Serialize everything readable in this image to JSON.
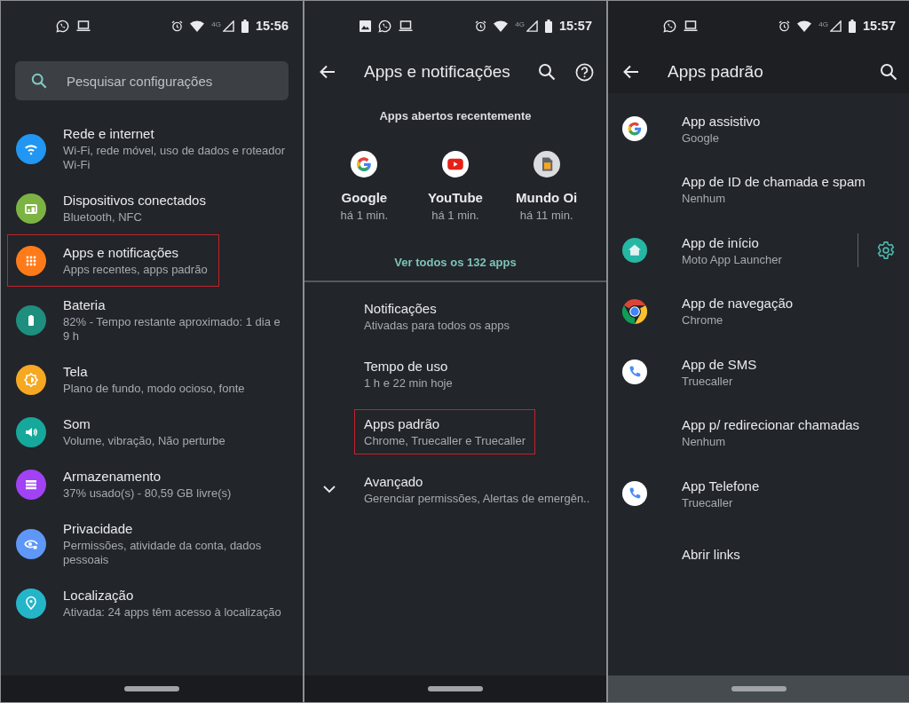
{
  "screens": [
    {
      "kind": "home",
      "status_bar": {
        "notifications": [
          {
            "kind": "chat"
          },
          {
            "kind": "laptop"
          }
        ],
        "network": "4G",
        "time": "15:56"
      },
      "search": {
        "placeholder": "Pesquisar configurações"
      },
      "items": [
        {
          "kind": "wifi",
          "color": "#2196f3",
          "title": "Rede e internet",
          "subtitle": "Wi-Fi, rede móvel, uso de dados e roteador Wi-Fi",
          "highlighted": false
        },
        {
          "kind": "devices",
          "color": "#7cb342",
          "title": "Dispositivos conectados",
          "subtitle": "Bluetooth, NFC",
          "highlighted": false
        },
        {
          "kind": "apps",
          "color": "#ff7b1a",
          "title": "Apps e notificações",
          "subtitle": "Apps recentes, apps padrão",
          "highlighted": true
        },
        {
          "kind": "battery",
          "color": "#1e8e7e",
          "title": "Bateria",
          "subtitle": "82% - Tempo restante aproximado: 1 dia e 9 h",
          "highlighted": false
        },
        {
          "kind": "display",
          "color": "#f6a823",
          "title": "Tela",
          "subtitle": "Plano de fundo, modo ocioso, fonte",
          "highlighted": false
        },
        {
          "kind": "sound",
          "color": "#16a89a",
          "title": "Som",
          "subtitle": "Volume, vibração, Não perturbe",
          "highlighted": false
        },
        {
          "kind": "storage",
          "color": "#a142f4",
          "title": "Armazenamento",
          "subtitle": "37% usado(s) - 80,59 GB livre(s)",
          "highlighted": false
        },
        {
          "kind": "privacy",
          "color": "#5e97f6",
          "title": "Privacidade",
          "subtitle": "Permissões, atividade da conta, dados pessoais",
          "highlighted": false
        },
        {
          "kind": "location",
          "color": "#24b5c9",
          "title": "Localização",
          "subtitle": "Ativada: 24 apps têm acesso à localização",
          "highlighted": false
        }
      ]
    },
    {
      "kind": "apps",
      "status_bar": {
        "notifications": [
          {
            "kind": "image"
          },
          {
            "kind": "chat"
          },
          {
            "kind": "laptop"
          }
        ],
        "network": "4G",
        "time": "15:57"
      },
      "toolbar": {
        "title": "Apps e notificações",
        "actions": [
          {
            "kind": "search"
          },
          {
            "kind": "help"
          }
        ]
      },
      "recent": {
        "heading": "Apps abertos recentemente",
        "apps": [
          {
            "kind": "google",
            "name": "Google",
            "time": "há 1 min."
          },
          {
            "kind": "youtube",
            "name": "YouTube",
            "time": "há 1 min."
          },
          {
            "kind": "sim",
            "name": "Mundo Oi",
            "time": "há 11 min."
          }
        ],
        "link": "Ver todos os 132 apps"
      },
      "items": [
        {
          "kind": "plain",
          "title": "Notificações",
          "subtitle": "Ativadas para todos os apps",
          "highlighted": false
        },
        {
          "kind": "plain",
          "title": "Tempo de uso",
          "subtitle": "1 h e 22 min hoje",
          "highlighted": false
        },
        {
          "kind": "plain",
          "title": "Apps padrão",
          "subtitle": "Chrome, Truecaller e Truecaller",
          "highlighted": true
        },
        {
          "kind": "expand",
          "title": "Avançado",
          "subtitle": "Gerenciar permissões, Alertas de emergên..",
          "highlighted": false
        }
      ]
    },
    {
      "kind": "defaults",
      "status_bar": {
        "notifications": [
          {
            "kind": "chat"
          },
          {
            "kind": "laptop"
          }
        ],
        "network": "4G",
        "time": "15:57"
      },
      "toolbar": {
        "title": "Apps padrão",
        "actions": [
          {
            "kind": "search"
          }
        ]
      },
      "items": [
        {
          "kind": "google",
          "title": "App assistivo",
          "subtitle": "Google",
          "settings": false
        },
        {
          "kind": "none",
          "title": "App de ID de chamada e spam",
          "subtitle": "Nenhum",
          "settings": false
        },
        {
          "kind": "home",
          "title": "App de início",
          "subtitle": "Moto App Launcher",
          "settings": true
        },
        {
          "kind": "chrome",
          "title": "App de navegação",
          "subtitle": "Chrome",
          "settings": false
        },
        {
          "kind": "phone",
          "title": "App de SMS",
          "subtitle": "Truecaller",
          "settings": false
        },
        {
          "kind": "none",
          "title": "App p/ redirecionar chamadas",
          "subtitle": "Nenhum",
          "settings": false
        },
        {
          "kind": "phone",
          "title": "App Telefone",
          "subtitle": "Truecaller",
          "settings": false
        },
        {
          "kind": "none",
          "title": "Abrir links",
          "settings": false
        }
      ]
    }
  ]
}
